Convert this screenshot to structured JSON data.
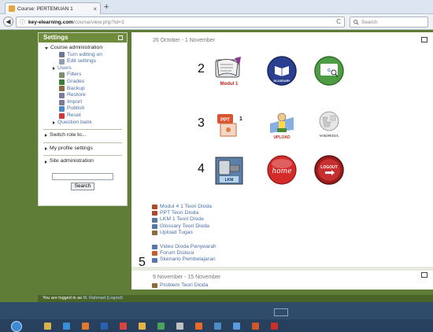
{
  "browser": {
    "tab_title": "Course: PERTEMUAN 1",
    "tab_close": "×",
    "new_tab": "+",
    "back": "◀",
    "url_info": "ⓘ",
    "url_host": "key-elearning.com",
    "url_path": "/course/view.php?id=3",
    "reload": "C",
    "search_placeholder": "Search",
    "search_icon": "magnifier-icon"
  },
  "sidebar": {
    "title": "Settings",
    "course_admin": "Course administration",
    "items": [
      {
        "label": "Turn editing on",
        "icon": "pencil-icon",
        "color": "#6b7b93"
      },
      {
        "label": "Edit settings",
        "icon": "settings-doc-icon",
        "color": "#8fa0b5"
      },
      {
        "label": "Users",
        "icon": "expand-arrow-icon",
        "color": "#333333"
      },
      {
        "label": "Filters",
        "icon": "funnel-icon",
        "color": "#7d8c6a"
      },
      {
        "label": "Grades",
        "icon": "grades-icon",
        "color": "#3e7d35"
      },
      {
        "label": "Backup",
        "icon": "backup-icon",
        "color": "#8a6b3d"
      },
      {
        "label": "Restore",
        "icon": "restore-icon",
        "color": "#7a7a9a"
      },
      {
        "label": "Import",
        "icon": "import-icon",
        "color": "#7a7a9a"
      },
      {
        "label": "Publish",
        "icon": "publish-icon",
        "color": "#4d8bc4"
      },
      {
        "label": "Reset",
        "icon": "reset-icon",
        "color": "#cc3b3b"
      },
      {
        "label": "Question bank",
        "icon": "expand-arrow-icon",
        "color": "#333333"
      }
    ],
    "switch_role": "Switch role to...",
    "profile_settings": "My profile settings",
    "site_admin": "Site administration",
    "search_button": "Search"
  },
  "main": {
    "section1_date": "26 October - 1 November",
    "row_numbers": [
      "2",
      "3",
      "4",
      "5"
    ],
    "icons": [
      {
        "name": "modul-icon",
        "caption": "Modul 1"
      },
      {
        "name": "glossary-icon",
        "caption": "GLOSSARY"
      },
      {
        "name": "google-icon",
        "caption": ""
      },
      {
        "name": "ppt-icon",
        "caption": "PPT 1"
      },
      {
        "name": "upload-icon",
        "caption": "UPLOAD"
      },
      {
        "name": "wikipedia-icon",
        "caption": "WIKIPEDIA"
      },
      {
        "name": "lkm-icon",
        "caption": "LKM"
      },
      {
        "name": "home-icon",
        "caption": "home"
      },
      {
        "name": "logout-icon",
        "caption": "LOGOUT"
      }
    ],
    "resources_a": [
      {
        "label": "Modul 4 1 Teori Dioda",
        "icon": "file-icon",
        "color": "#b04a2f"
      },
      {
        "label": "PPT Teori Dioda",
        "icon": "file-icon",
        "color": "#b04a2f"
      },
      {
        "label": "LKM 1 Teori Dioda",
        "icon": "file-icon",
        "color": "#5577aa"
      },
      {
        "label": "Glossary Teori Dioda",
        "icon": "glossary-small-icon",
        "color": "#5577aa"
      },
      {
        "label": "Upload Tugas",
        "icon": "assignment-icon",
        "color": "#8a6b3d"
      }
    ],
    "resources_b": [
      {
        "label": "Video Dioda Penyearah",
        "icon": "page-icon",
        "color": "#5577aa"
      },
      {
        "label": "Forum Diskusi",
        "icon": "forum-icon",
        "color": "#c75b2c"
      },
      {
        "label": "Skenario Pembelajaran",
        "icon": "page-icon",
        "color": "#5577aa"
      }
    ],
    "section2_date": "9 November - 15 November",
    "section2_item": {
      "label": "Problem Teori Dioda",
      "icon": "assignment-icon",
      "color": "#8a6b3d"
    }
  },
  "footer": {
    "logged_text": "You are logged in as",
    "user_name": "M. Rahmad",
    "logout_text": "(Logout)"
  },
  "taskbar": {
    "start_icon": "windows-start-icon",
    "apps": [
      {
        "name": "explorer-icon",
        "color": "#d8b24a"
      },
      {
        "name": "ie-icon",
        "color": "#3a8fd9"
      },
      {
        "name": "media-icon",
        "color": "#e07a2e"
      },
      {
        "name": "word-icon",
        "color": "#2b5fb0"
      },
      {
        "name": "chrome-icon",
        "color": "#d9453a"
      },
      {
        "name": "folder-icon",
        "color": "#e3b341"
      },
      {
        "name": "paint-icon",
        "color": "#4aa35a"
      },
      {
        "name": "music-icon",
        "color": "#c0c0c0"
      },
      {
        "name": "firefox-icon",
        "color": "#e86a24"
      },
      {
        "name": "app-icon",
        "color": "#4d8bc4"
      },
      {
        "name": "network-icon",
        "color": "#5a9ae0"
      },
      {
        "name": "powerpoint-icon",
        "color": "#d2562c"
      },
      {
        "name": "pdf-icon",
        "color": "#c8302b"
      }
    ]
  }
}
